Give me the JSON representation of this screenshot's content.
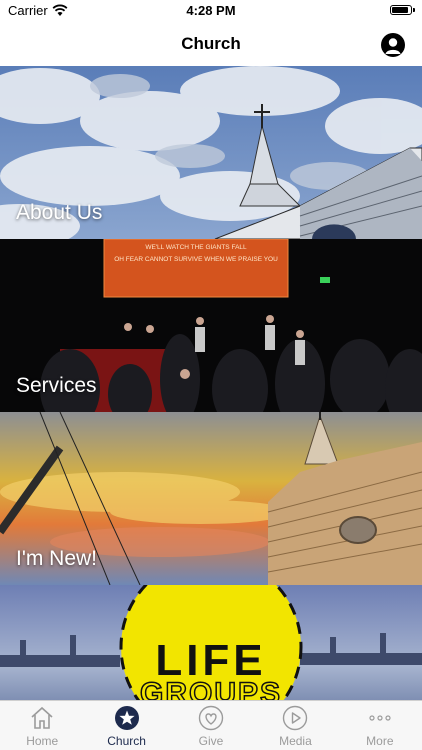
{
  "status_bar": {
    "carrier": "Carrier",
    "time": "4:28 PM",
    "battery_level": 0.95
  },
  "nav": {
    "title": "Church",
    "profile_icon": "person-circle-icon"
  },
  "tiles": [
    {
      "label": "About Us"
    },
    {
      "label": "Services",
      "screen_line1": "WE'LL WATCH THE GIANTS FALL",
      "screen_line2": "OH FEAR CANNOT SURVIVE WHEN WE PRAISE YOU"
    },
    {
      "label": "I'm New!"
    },
    {
      "label": "",
      "logo_text_1": "LIFE",
      "logo_text_2": "GROUPS"
    }
  ],
  "tab_bar": {
    "tabs": [
      {
        "label": "Home",
        "icon": "house-icon",
        "active": false
      },
      {
        "label": "Church",
        "icon": "star-circle-icon",
        "active": true
      },
      {
        "label": "Give",
        "icon": "heart-circle-icon",
        "active": false
      },
      {
        "label": "Media",
        "icon": "play-circle-icon",
        "active": false
      },
      {
        "label": "More",
        "icon": "ellipsis-icon",
        "active": false
      }
    ]
  },
  "colors": {
    "tab_active": "#1d2a4d",
    "tab_inactive": "#9b9b9b",
    "life_groups_yellow": "#f2e500"
  }
}
